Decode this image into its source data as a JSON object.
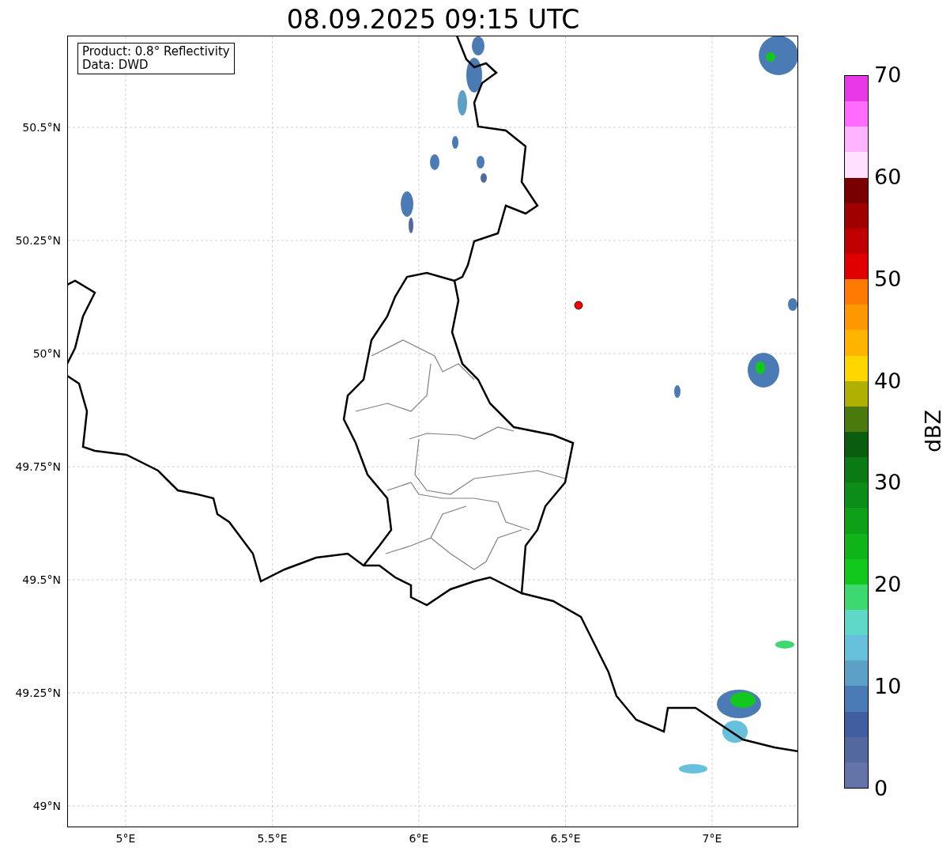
{
  "title": "08.09.2025 09:15 UTC",
  "legend": [
    "Product: 0.8° Reflectivity",
    "Data: DWD"
  ],
  "lat_ticks": [
    "50.5°N",
    "50.25°N",
    "50°N",
    "49.75°N",
    "49.5°N",
    "49.25°N",
    "49°N"
  ],
  "lon_ticks": [
    "5°E",
    "5.5°E",
    "6°E",
    "6.5°E",
    "7°E"
  ],
  "colorbar": {
    "label": "dBZ",
    "ticks": [
      "70",
      "60",
      "50",
      "40",
      "30",
      "20",
      "10",
      "0"
    ],
    "segments": [
      {
        "color": "#e838e8"
      },
      {
        "color": "#ff6cff"
      },
      {
        "color": "#ffb4ff"
      },
      {
        "color": "#ffe0ff"
      },
      {
        "color": "#780000"
      },
      {
        "color": "#a00000"
      },
      {
        "color": "#c00000"
      },
      {
        "color": "#e00000"
      },
      {
        "color": "#ff7a00"
      },
      {
        "color": "#ff9800"
      },
      {
        "color": "#ffb400"
      },
      {
        "color": "#ffd700"
      },
      {
        "color": "#b0b000"
      },
      {
        "color": "#4a7a0c"
      },
      {
        "color": "#0a5c0e"
      },
      {
        "color": "#0c7a14"
      },
      {
        "color": "#0c8c18"
      },
      {
        "color": "#0ea018"
      },
      {
        "color": "#10b418"
      },
      {
        "color": "#12c81c"
      },
      {
        "color": "#3ed870"
      },
      {
        "color": "#60d8c8"
      },
      {
        "color": "#66c0dc"
      },
      {
        "color": "#5ca0c8"
      },
      {
        "color": "#4b7bb4"
      },
      {
        "color": "#405ea0"
      },
      {
        "color": "#5468a0"
      },
      {
        "color": "#6574a8"
      }
    ]
  }
}
